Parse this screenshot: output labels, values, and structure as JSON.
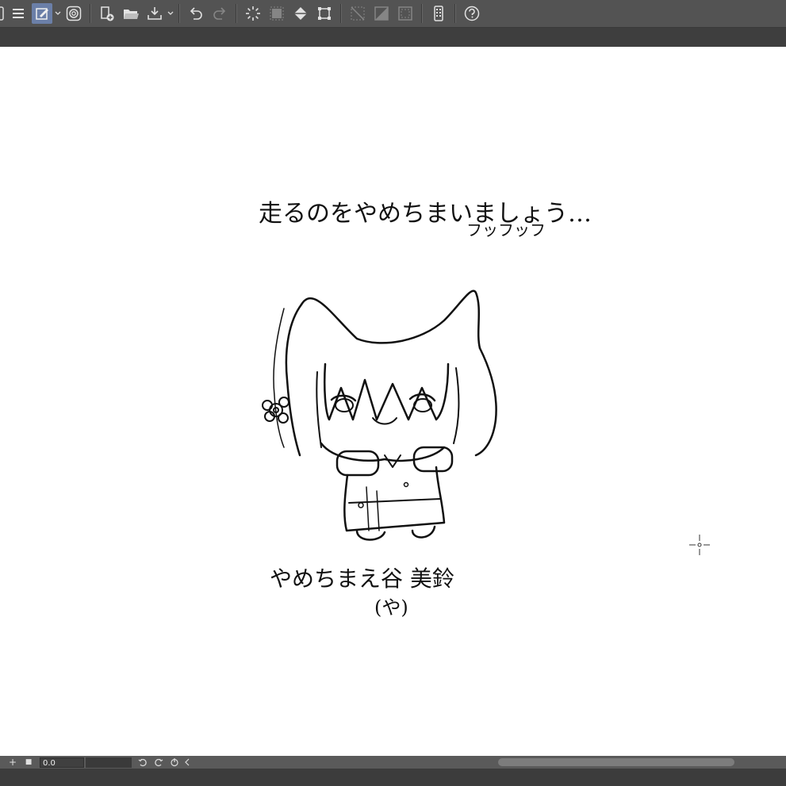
{
  "toolbar": {
    "icons": [
      "panel-icon",
      "menu-icon",
      "edit-mode-icon",
      "chevron-down-icon",
      "clip-studio-icon",
      "new-file-icon",
      "open-folder-icon",
      "save-icon",
      "chevron-down-icon",
      "undo-icon",
      "redo-icon",
      "clear-icon",
      "clear-selection-icon",
      "fill-icon",
      "transform-icon",
      "hide-selection-icon",
      "crop-icon",
      "selection-border-icon",
      "smartphone-icon",
      "help-icon"
    ]
  },
  "canvas": {
    "heading_line1": "走るのをやめちまいましょう…",
    "heading_line2": "フッフッフ",
    "name_line1": "やめちまえ谷 美鈴",
    "name_line2": "(や)"
  },
  "statusbar": {
    "add_label": "+",
    "stop_label": "■",
    "zoom_value": "0.0",
    "zoom_fill": 0.0
  },
  "colors": {
    "toolbar_bg": "#535353",
    "subbar_bg": "#3e3e3e",
    "active_tool": "#6b7fa8",
    "canvas_bg": "#ffffff"
  }
}
